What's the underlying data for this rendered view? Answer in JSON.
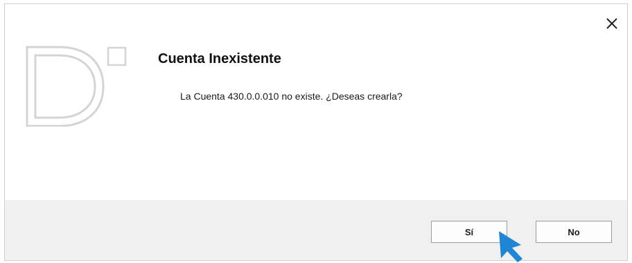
{
  "dialog": {
    "title": "Cuenta Inexistente",
    "message": "La Cuenta 430.0.0.010 no existe. ¿Deseas crearla?",
    "close_icon": "close-icon",
    "logo_icon": "app-logo-icon",
    "buttons": {
      "yes_label": "Sí",
      "no_label": "No"
    }
  },
  "pointer": {
    "icon": "mouse-pointer-icon",
    "color": "#1f86d6"
  },
  "colors": {
    "footer_bg": "#f0f0f0",
    "logo_stroke": "#d4d4d4",
    "button_border": "#9a9a9a"
  }
}
